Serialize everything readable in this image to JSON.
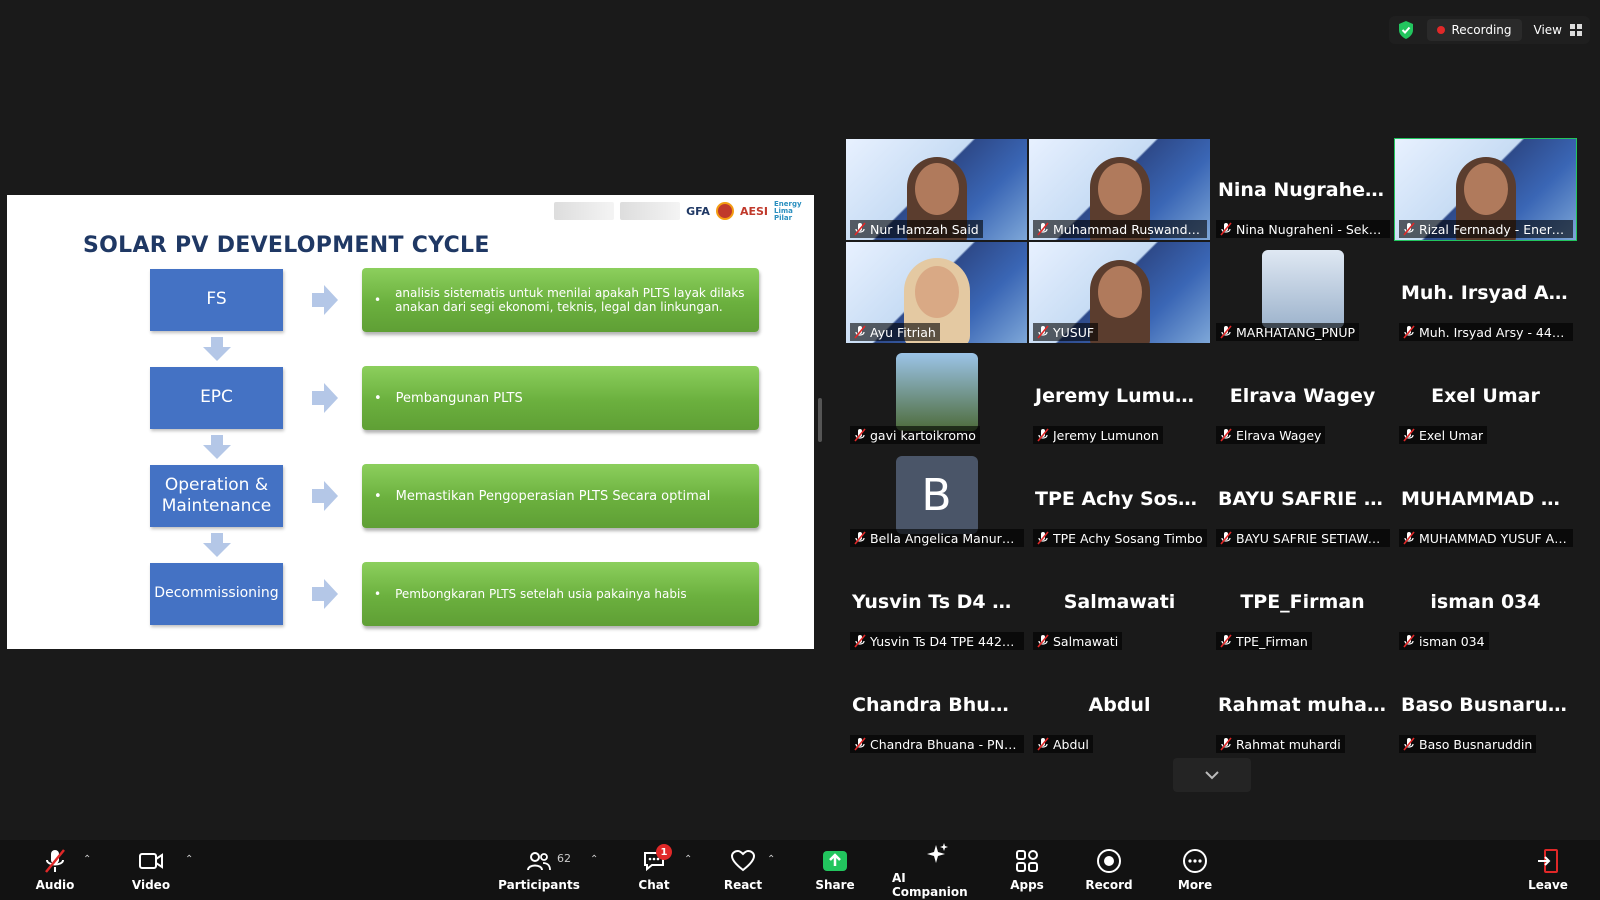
{
  "status": {
    "recording_label": "Recording",
    "view_label": "View"
  },
  "slide": {
    "title": "SOLAR PV DEVELOPMENT CYCLE",
    "logo_texts": [
      "GFA",
      "AESI",
      "Energy Lima Pilar"
    ],
    "steps": [
      {
        "label": "FS",
        "desc": "analisis sistematis untuk menilai apakah PLTS  layak dilaks anakan dari segi ekonomi, teknis, legal dan linkungan."
      },
      {
        "label": "EPC",
        "desc": "Pembangunan PLTS"
      },
      {
        "label": "Operation & Maintenance",
        "desc": "Memastikan Pengoperasian PLTS Secara optimal"
      },
      {
        "label": "Decommissioning",
        "desc": "Pembongkaran PLTS setelah usia pakainya habis"
      }
    ],
    "bullet": "•"
  },
  "gallery": {
    "tiles": [
      {
        "name": "Nur Hamzah Said",
        "type": "video"
      },
      {
        "name": "Muhammad Ruswandi Dj...",
        "type": "video"
      },
      {
        "name": "Nina Nugraheni - Sekreta...",
        "center": "Nina  Nugraheni...",
        "type": "name"
      },
      {
        "name": "Rizal Fernnady - Energy Lima...",
        "type": "video",
        "active": true
      },
      {
        "name": "Ayu Fitriah",
        "type": "video"
      },
      {
        "name": "YUSUF",
        "type": "video"
      },
      {
        "name": "MARHATANG_PNUP",
        "type": "photo"
      },
      {
        "name": "Muh. Irsyad Arsy - 44225...",
        "center": "Muh.  Irsyad  Ars...",
        "type": "name"
      },
      {
        "name": "gavi kartoikromo",
        "type": "photo"
      },
      {
        "name": "Jeremy Lumunon",
        "center": "Jeremy  Lumunon",
        "type": "name"
      },
      {
        "name": "Elrava Wagey",
        "center": "Elrava  Wagey",
        "type": "name"
      },
      {
        "name": "Exel Umar",
        "center": "Exel  Umar",
        "type": "name"
      },
      {
        "name": "Bella Angelica Manurung",
        "type": "letter",
        "letter": "B"
      },
      {
        "name": "TPE Achy Sosang Timbo",
        "center": "TPE  Achy  Sosan...",
        "type": "name"
      },
      {
        "name": "BAYU SAFRIE SETIAWAN_...",
        "center": "BAYU  SAFRIE  SE...",
        "type": "name"
      },
      {
        "name": "MUHAMMAD YUSUF AL J...",
        "center": "MUHAMMAD  Y...",
        "type": "name"
      },
      {
        "name": "Yusvin Ts D4 TPE 442230...",
        "center": "Yusvin  Ts  D4  TP...",
        "type": "name"
      },
      {
        "name": "Salmawati",
        "center": "Salmawati",
        "type": "name"
      },
      {
        "name": "TPE_Firman",
        "center": "TPE_Firman",
        "type": "name"
      },
      {
        "name": "isman 034",
        "center": "isman  034",
        "type": "name"
      },
      {
        "name": "Chandra Bhuana - PNUP",
        "center": "Chandra  Bhuan...",
        "type": "name"
      },
      {
        "name": "Abdul",
        "center": "Abdul",
        "type": "name"
      },
      {
        "name": "Rahmat muhardi",
        "center": "Rahmat  muhardi",
        "type": "name"
      },
      {
        "name": "Baso Busnaruddin",
        "center": "Baso  Busnaruddin",
        "type": "name"
      }
    ]
  },
  "toolbar": {
    "audio": "Audio",
    "video": "Video",
    "participants": "Participants",
    "participants_count": "62",
    "chat": "Chat",
    "chat_badge": "1",
    "react": "React",
    "share": "Share",
    "ai": "AI Companion",
    "apps": "Apps",
    "record": "Record",
    "more": "More",
    "leave": "Leave"
  },
  "colors": {
    "accent_green": "#22c55e",
    "slide_blue": "#4472c4",
    "slide_green": "#6bb03e",
    "record_red": "#e02828"
  }
}
